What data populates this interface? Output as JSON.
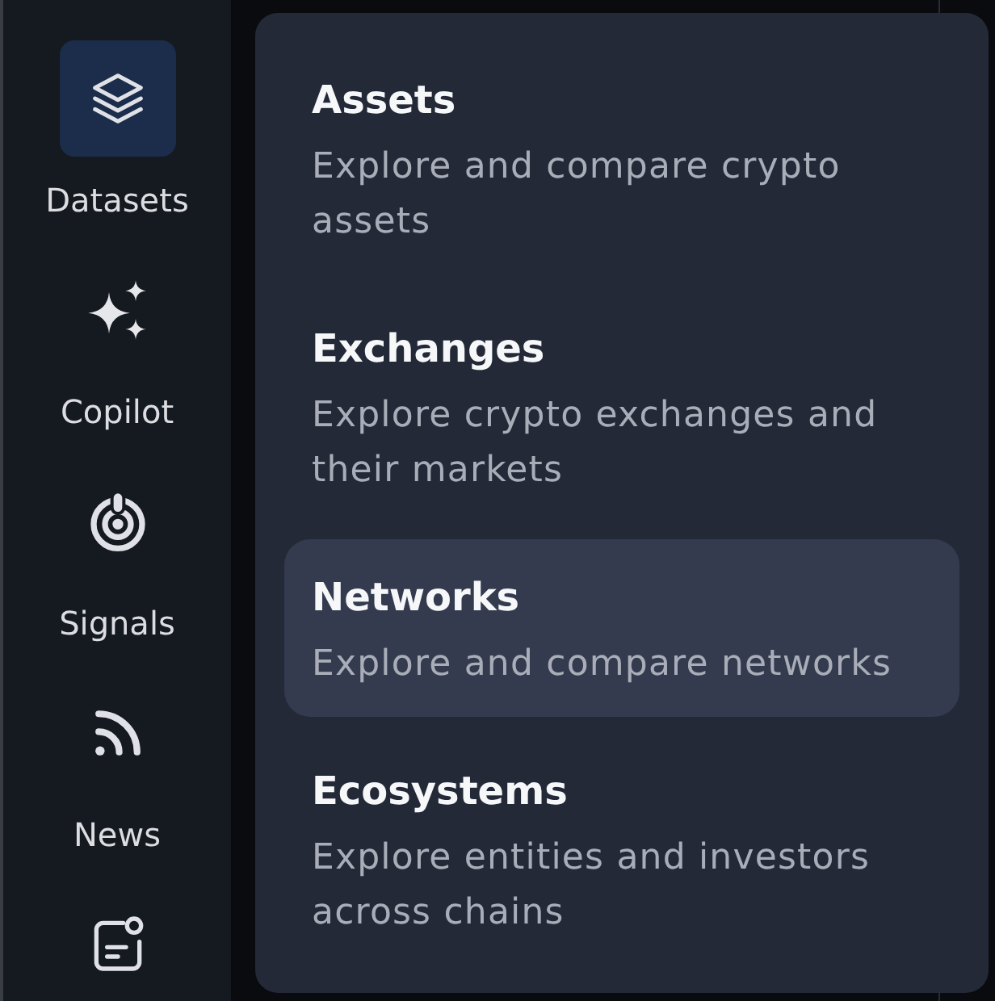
{
  "sidebar": {
    "items": [
      {
        "label": "Datasets",
        "selected": true
      },
      {
        "label": "Copilot",
        "selected": false
      },
      {
        "label": "Signals",
        "selected": false
      },
      {
        "label": "News",
        "selected": false
      },
      {
        "selected": false
      }
    ]
  },
  "menu": {
    "items": [
      {
        "title": "Assets",
        "description": "Explore and compare crypto assets",
        "selected": false
      },
      {
        "title": "Exchanges",
        "description": "Explore crypto exchanges and their markets",
        "selected": false
      },
      {
        "title": "Networks",
        "description": "Explore and compare networks",
        "selected": true
      },
      {
        "title": "Ecosystems",
        "description": "Explore entities and investors across chains",
        "selected": false
      }
    ]
  }
}
